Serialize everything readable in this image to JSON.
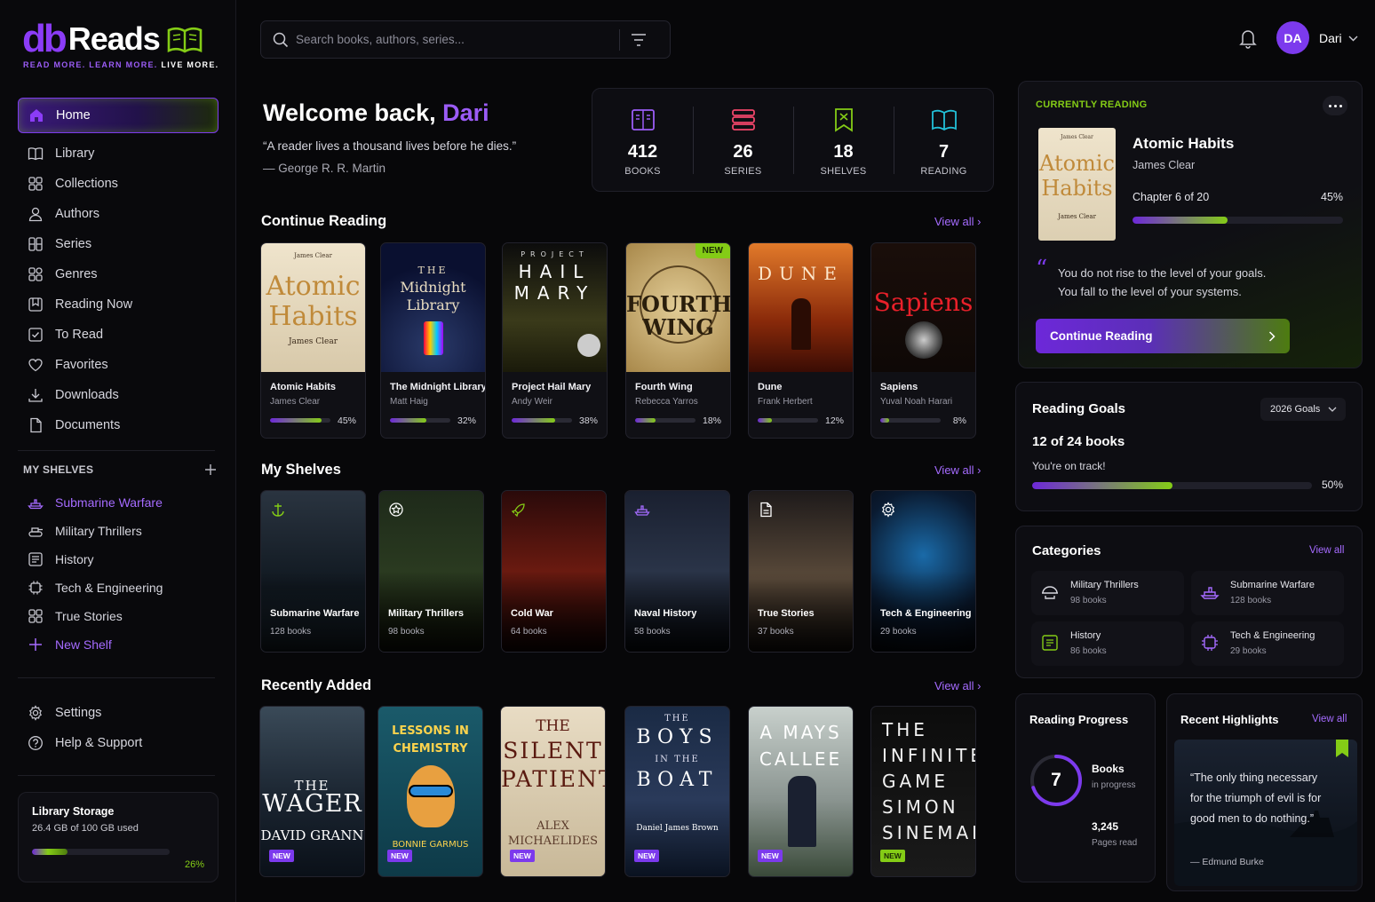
{
  "brand": {
    "logo_db": "db",
    "logo_reads": "Reads",
    "tagline_a": "READ MORE. LEARN MORE.",
    "tagline_b": "LIVE MORE.",
    "accent": "#8b3cf7",
    "green": "#84cc16"
  },
  "nav": {
    "items": [
      {
        "label": "Home",
        "icon": "home-icon"
      },
      {
        "label": "Library",
        "icon": "book-open-icon"
      },
      {
        "label": "Collections",
        "icon": "grid-icon"
      },
      {
        "label": "Authors",
        "icon": "user-icon"
      },
      {
        "label": "Series",
        "icon": "series-icon"
      },
      {
        "label": "Genres",
        "icon": "genres-icon"
      },
      {
        "label": "Reading Now",
        "icon": "bookmark-icon"
      },
      {
        "label": "To Read",
        "icon": "checkbox-icon"
      },
      {
        "label": "Favorites",
        "icon": "heart-icon"
      },
      {
        "label": "Downloads",
        "icon": "download-icon"
      },
      {
        "label": "Documents",
        "icon": "document-icon"
      }
    ]
  },
  "shelves": {
    "heading": "MY SHELVES",
    "items": [
      {
        "label": "Submarine Warfare",
        "icon": "submarine-icon"
      },
      {
        "label": "Military Thrillers",
        "icon": "tank-icon"
      },
      {
        "label": "History",
        "icon": "history-icon"
      },
      {
        "label": "Tech & Engineering",
        "icon": "circuit-icon"
      },
      {
        "label": "True Stories",
        "icon": "stories-icon"
      }
    ],
    "new_shelf": "New Shelf"
  },
  "footer_nav": {
    "settings": "Settings",
    "help": "Help & Support"
  },
  "storage": {
    "title": "Library Storage",
    "used": "26.4 GB of 100 GB used",
    "percent_label": "26%",
    "fraction": 0.26
  },
  "search": {
    "placeholder": "Search books, authors, series..."
  },
  "user": {
    "initials": "DA",
    "name": "Dari"
  },
  "welcome": {
    "prefix": "Welcome back,",
    "name": "Dari",
    "quote": "“A reader lives a thousand lives before he dies.”",
    "author": "— George R. R. Martin"
  },
  "stats": [
    {
      "value": "412",
      "label": "BOOKS",
      "icon": "book-icon"
    },
    {
      "value": "26",
      "label": "SERIES",
      "icon": "stack-icon"
    },
    {
      "value": "18",
      "label": "SHELVES",
      "icon": "bookmark-x-icon"
    },
    {
      "value": "7",
      "label": "READING",
      "icon": "open-book-icon"
    }
  ],
  "continue_reading": {
    "title": "Continue Reading",
    "view_all": "View all",
    "books": [
      {
        "title": "Atomic Habits",
        "author": "James Clear",
        "pct_label": "45%",
        "progress": 0.45,
        "cover_lines": [
          "Atomic",
          "Habits"
        ],
        "cover_top": "James Clear",
        "cover_bottom": "Jᴀᴍᴇs Clᴇᴀʀ"
      },
      {
        "title": "The Midnight Library",
        "author": "Matt Haig",
        "pct_label": "32%",
        "progress": 0.32,
        "cover_lines": [
          "THE",
          "Midnight",
          "Library"
        ]
      },
      {
        "title": "Project Hail Mary",
        "author": "Andy Weir",
        "pct_label": "38%",
        "progress": 0.38,
        "cover_lines": [
          "PROJECT",
          "HAIL",
          "MARY"
        ]
      },
      {
        "title": "Fourth Wing",
        "author": "Rebecca Yarros",
        "pct_label": "18%",
        "progress": 0.18,
        "cover_lines": [
          "FOURTH",
          "WING"
        ],
        "badge": "NEW"
      },
      {
        "title": "Dune",
        "author": "Frank Herbert",
        "pct_label": "12%",
        "progress": 0.12,
        "cover_lines": [
          "DUNE"
        ]
      },
      {
        "title": "Sapiens",
        "author": "Yuval Noah Harari",
        "pct_label": "8%",
        "progress": 0.08,
        "cover_lines": [
          "Sapiens"
        ]
      }
    ]
  },
  "my_shelves": {
    "title": "My Shelves",
    "view_all": "View all",
    "items": [
      {
        "name": "Submarine Warfare",
        "count": "128 books",
        "icon": "anchor-icon"
      },
      {
        "name": "Military Thrillers",
        "count": "98 books",
        "icon": "star-badge-icon"
      },
      {
        "name": "Cold War",
        "count": "64 books",
        "icon": "rocket-icon"
      },
      {
        "name": "Naval History",
        "count": "58 books",
        "icon": "ship-icon"
      },
      {
        "name": "True Stories",
        "count": "37 books",
        "icon": "document-icon"
      },
      {
        "name": "Tech & Engineering",
        "count": "29 books",
        "icon": "gear-icon"
      }
    ]
  },
  "recently_added": {
    "title": "Recently Added",
    "view_all": "View all",
    "badge": "NEW",
    "books": [
      {
        "l1": "THE",
        "l2": "WAGER",
        "l3": "DAVID GRANN"
      },
      {
        "l1": "LESSONS IN",
        "l2": "CHEMISTRY",
        "l3": "BONNIE GARMUS"
      },
      {
        "l1": "THE",
        "l2": "SILENT",
        "l2b": "PATIENT",
        "l3": "ALEX",
        "l4": "MICHAELIDES"
      },
      {
        "l1": "THE",
        "l2": "BOYS",
        "l2a": "IN THE",
        "l2b": "BOAT",
        "l3": "Daniel James Brown"
      },
      {
        "l1": "A MAYS",
        "l2": "CALLEE"
      },
      {
        "l1": "THE",
        "l2": "INFINITE",
        "l2a": "GAME",
        "l3": "SIMON",
        "l4": "SINEMAN"
      }
    ]
  },
  "current": {
    "label": "CURRENTLY READING",
    "title": "Atomic Habits",
    "author": "James Clear",
    "chapter": "Chapter 6 of 20",
    "pct_label": "45%",
    "progress": 0.45,
    "quote_1": "You do not rise to the level of your goals.",
    "quote_2": "You fall to the level of your systems.",
    "button": "Continue Reading"
  },
  "goals": {
    "title": "Reading Goals",
    "selector": "2026 Goals",
    "count": "12 of 24 books",
    "status": "You're on track!",
    "pct_label": "50%",
    "progress": 0.5
  },
  "categories": {
    "title": "Categories",
    "view_all": "View all",
    "items": [
      {
        "name": "Military Thrillers",
        "count": "98 books",
        "icon": "helmet-icon"
      },
      {
        "name": "Submarine Warfare",
        "count": "128 books",
        "icon": "submarine-icon"
      },
      {
        "name": "History",
        "count": "86 books",
        "icon": "history-book-icon"
      },
      {
        "name": "Tech & Engineering",
        "count": "29 books",
        "icon": "circuit-icon"
      }
    ]
  },
  "progress": {
    "title": "Reading Progress",
    "ring_value": "7",
    "books_label": "Books",
    "books_sub": "in progress",
    "pages": "3,245",
    "pages_label": "Pages read",
    "ring_fraction": 0.7
  },
  "highlights": {
    "title": "Recent Highlights",
    "view_all": "View all",
    "quote": "“The only thing necessary for the triumph of evil is for good men to do nothing.”",
    "author": "— Edmund Burke"
  }
}
